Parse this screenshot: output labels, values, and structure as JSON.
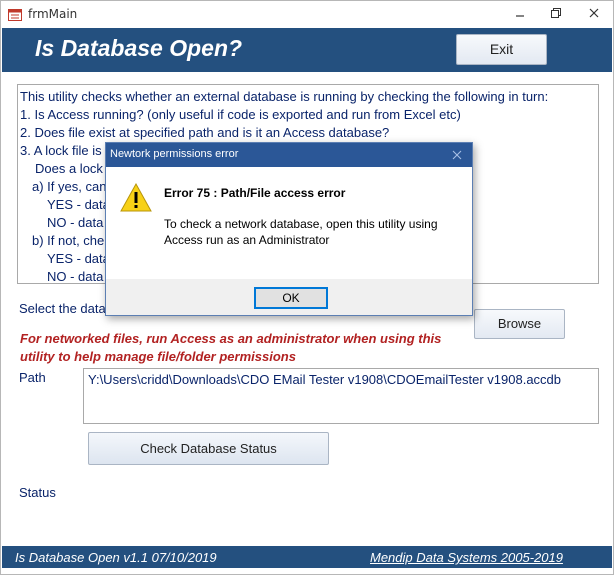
{
  "window": {
    "title": "frmMain"
  },
  "header": {
    "title": "Is Database Open?",
    "exit_label": "Exit",
    "color": "#24507f"
  },
  "info": {
    "lines": [
      "This utility checks whether an external database is running by checking the following in turn:",
      "1. Is Access running? (only useful if code is exported and run from Excel etc)",
      "2. Does file exist at specified path and is it an Access database?",
      "3. A lock file is",
      "Does a lock",
      "a) If yes, can",
      "YES - data",
      "NO - data",
      "b) If not, che",
      "YES - data",
      "NO - data"
    ]
  },
  "form": {
    "select_label": "Select the data",
    "warning": "For networked files, run Access as an administrator when using this utility to help manage file/folder permissions",
    "warning_color": "#b22222",
    "browse_label": "Browse",
    "path_label": "Path",
    "path_value": "Y:\\Users\\cridd\\Downloads\\CDO EMail Tester v1908\\CDOEmailTester v1908.accdb",
    "check_label": "Check Database Status",
    "status_label": "Status"
  },
  "footer": {
    "left": "Is Database Open v1.1  07/10/2019",
    "right": "Mendip Data Systems 2005-2019"
  },
  "dialog": {
    "title": "Newtork permissions error",
    "error": "Error 75 :  Path/File access error",
    "message_line1": "To check a network database, open this utility using",
    "message_line2": "Access run as an Administrator",
    "ok_label": "OK",
    "icon": "warning-icon"
  }
}
